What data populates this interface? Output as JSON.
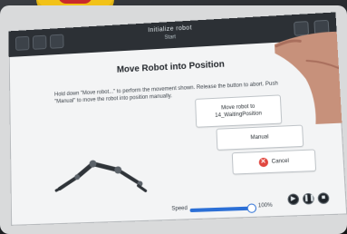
{
  "header": {
    "title": "Initialize robot",
    "subtitle": "Start"
  },
  "main": {
    "title": "Move Robot into Position",
    "instruction": "Hold down \"Move robot...\" to perform the movement shown. Release the button to abort. Push \"Manual\" to move the robot into position manually.",
    "buttons": {
      "move_robot_line1": "Move robot to",
      "move_robot_line2": "14_WaitingPosition",
      "manual": "Manual",
      "cancel": "Cancel"
    }
  },
  "footer": {
    "speed_label": "Speed",
    "speed_value": "100%",
    "speed_fraction": 1.0
  },
  "icons": {
    "cancel": "cancel-x-icon",
    "robot_arm": "robot-arm-icon"
  },
  "colors": {
    "accent": "#2b6fd6",
    "danger": "#e1473f",
    "header": "#2c3035",
    "emergency_yellow": "#f2c218",
    "emergency_red": "#c92a2a"
  }
}
